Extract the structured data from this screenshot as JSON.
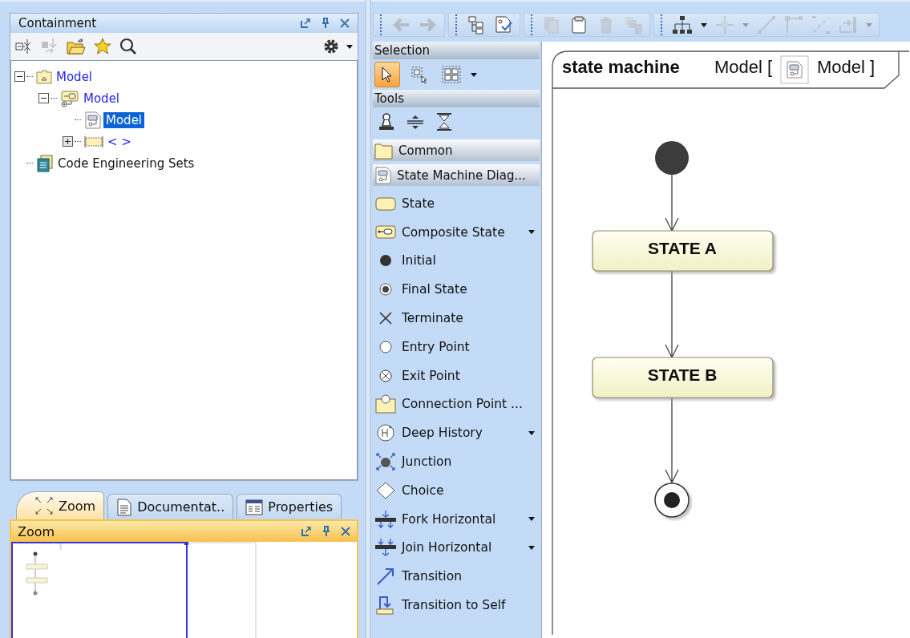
{
  "containment": {
    "title": "Containment",
    "toolbar": [
      {
        "kind": "collapse",
        "disabled": false
      },
      {
        "kind": "sync",
        "disabled": true
      },
      {
        "kind": "open-folder",
        "disabled": false
      },
      {
        "kind": "star",
        "disabled": false
      },
      {
        "kind": "search",
        "disabled": false
      }
    ],
    "tree": [
      {
        "label": "Model",
        "kind": "package",
        "expanded": true,
        "selected": false,
        "children": [
          {
            "label": "Model",
            "kind": "state-machine",
            "expanded": true,
            "selected": false,
            "children": [
              {
                "label": "Model",
                "kind": "diagram",
                "selected": true
              },
              {
                "label": "< >",
                "kind": "region",
                "expanded": false,
                "selected": false
              }
            ]
          }
        ]
      },
      {
        "label": "Code Engineering Sets",
        "kind": "code-sets",
        "selected": false
      }
    ]
  },
  "bottom_tabs": [
    {
      "label": "Zoom",
      "kind": "zoom",
      "selected": true
    },
    {
      "label": "Documentat..",
      "kind": "doc",
      "selected": false
    },
    {
      "label": "Properties",
      "kind": "props",
      "selected": false
    }
  ],
  "zoom_panel": {
    "title": "Zoom"
  },
  "toolbar": [
    {
      "kind": "back",
      "disabled": true
    },
    {
      "kind": "forward",
      "disabled": true
    },
    {
      "kind": "tree",
      "disabled": false
    },
    {
      "kind": "validate",
      "disabled": false
    },
    {
      "kind": "copy",
      "disabled": true
    },
    {
      "kind": "paste",
      "disabled": false
    },
    {
      "kind": "delete",
      "disabled": true
    },
    {
      "kind": "delete-all",
      "disabled": true
    },
    {
      "kind": "hierarchy",
      "disabled": false
    },
    {
      "kind": "split",
      "disabled": true
    },
    {
      "kind": "line",
      "disabled": true
    },
    {
      "kind": "elbow",
      "disabled": true
    },
    {
      "kind": "dashed",
      "disabled": true
    },
    {
      "kind": "reroute",
      "disabled": true
    }
  ],
  "palette": {
    "selection_header": "Selection",
    "selection_tools": [
      {
        "kind": "pointer",
        "selected": true
      },
      {
        "kind": "marquee",
        "selected": false
      },
      {
        "kind": "group",
        "selected": false
      }
    ],
    "tools_header": "Tools",
    "sections": [
      {
        "label": "Common",
        "kind": "folder"
      },
      {
        "label": "State Machine Diag...",
        "kind": "diagram"
      }
    ],
    "items": [
      {
        "label": "State",
        "kind": "state",
        "menu": false
      },
      {
        "label": "Composite State",
        "kind": "composite",
        "menu": true
      },
      {
        "label": "Initial",
        "kind": "initial",
        "menu": false
      },
      {
        "label": "Final State",
        "kind": "final",
        "menu": false
      },
      {
        "label": "Terminate",
        "kind": "terminate",
        "menu": false
      },
      {
        "label": "Entry Point",
        "kind": "entry",
        "menu": false
      },
      {
        "label": "Exit Point",
        "kind": "exit",
        "menu": false
      },
      {
        "label": "Connection Point ...",
        "kind": "connection",
        "menu": false
      },
      {
        "label": "Deep History",
        "kind": "history",
        "menu": true
      },
      {
        "label": "Junction",
        "kind": "junction",
        "menu": false
      },
      {
        "label": "Choice",
        "kind": "choice",
        "menu": false
      },
      {
        "label": "Fork Horizontal",
        "kind": "fork",
        "menu": true
      },
      {
        "label": "Join Horizontal",
        "kind": "join",
        "menu": true
      },
      {
        "label": "Transition",
        "kind": "transition",
        "menu": false
      },
      {
        "label": "Transition to Self",
        "kind": "self",
        "menu": false
      }
    ]
  },
  "diagram": {
    "keyword": "state machine",
    "name": "Model [",
    "owner": "Model ]",
    "states": [
      "STATE A",
      "STATE B"
    ]
  }
}
